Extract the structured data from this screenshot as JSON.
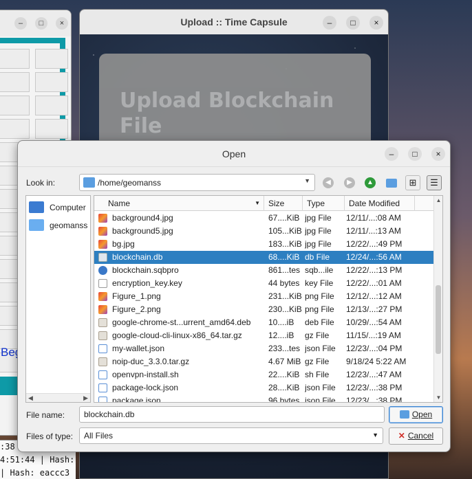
{
  "left_window": {
    "link_text": "Beg",
    "log_lines": [
      ":38  | Hash: 0ge",
      "4:51:44  | Hash:",
      "| Hash: eaccc3"
    ]
  },
  "upload_window": {
    "title": "Upload :: Time Capsule",
    "heading": "Upload Blockchain File"
  },
  "dialog": {
    "title": "Open",
    "look_in_label": "Look in:",
    "look_in_path": "/home/geomanss",
    "sidebar": [
      {
        "label": "Computer",
        "icon": "computer-icon"
      },
      {
        "label": "geomanss",
        "icon": "folder-icon"
      }
    ],
    "columns": {
      "name": "Name",
      "size": "Size",
      "type": "Type",
      "modified": "Date Modified"
    },
    "files": [
      {
        "name": "background4.jpg",
        "size": "67....KiB",
        "type": "jpg File",
        "modified": "12/11/...:08 AM",
        "icon": "img"
      },
      {
        "name": "background5.jpg",
        "size": "105...KiB",
        "type": "jpg File",
        "modified": "12/11/...:13 AM",
        "icon": "img"
      },
      {
        "name": "bg.jpg",
        "size": "183...KiB",
        "type": "jpg File",
        "modified": "12/22/...:49 PM",
        "icon": "img"
      },
      {
        "name": "blockchain.db",
        "size": "68....KiB",
        "type": "db File",
        "modified": "12/24/...:56 AM",
        "icon": "db",
        "selected": true
      },
      {
        "name": "blockchain.sqbpro",
        "size": "861...tes",
        "type": "sqb...ile",
        "modified": "12/22/...:13 PM",
        "icon": "sqb"
      },
      {
        "name": "encryption_key.key",
        "size": "44 bytes",
        "type": "key File",
        "modified": "12/22/...:01 AM",
        "icon": "doc"
      },
      {
        "name": "Figure_1.png",
        "size": "231...KiB",
        "type": "png File",
        "modified": "12/12/...:12 AM",
        "icon": "img"
      },
      {
        "name": "Figure_2.png",
        "size": "230...KiB",
        "type": "png File",
        "modified": "12/13/...:27 PM",
        "icon": "img"
      },
      {
        "name": "google-chrome-st...urrent_amd64.deb",
        "size": "10....iB",
        "type": "deb File",
        "modified": "10/29/...:54 AM",
        "icon": "arc"
      },
      {
        "name": "google-cloud-cli-linux-x86_64.tar.gz",
        "size": "12....iB",
        "type": "gz File",
        "modified": "11/15/...:19 AM",
        "icon": "arc"
      },
      {
        "name": "my-wallet.json",
        "size": "233...tes",
        "type": "json File",
        "modified": "12/23/...:04 PM",
        "icon": "json"
      },
      {
        "name": "noip-duc_3.3.0.tar.gz",
        "size": "4.67 MiB",
        "type": "gz File",
        "modified": "9/18/24 5:22 AM",
        "icon": "arc"
      },
      {
        "name": "openvpn-install.sh",
        "size": "22....KiB",
        "type": "sh File",
        "modified": "12/23/...:47 AM",
        "icon": "json"
      },
      {
        "name": "package-lock.json",
        "size": "28....KiB",
        "type": "json File",
        "modified": "12/23/...:38 PM",
        "icon": "json"
      },
      {
        "name": "package.json",
        "size": "96 bytes",
        "type": "json File",
        "modified": "12/23/...:38 PM",
        "icon": "json"
      }
    ],
    "file_name_label": "File name:",
    "file_name_value": "blockchain.db",
    "file_type_label": "Files of type:",
    "file_type_value": "All Files",
    "open_button": "Open",
    "cancel_button": "Cancel"
  },
  "colors": {
    "accent": "#2d7fc1",
    "teal": "#0e9aa7",
    "link_blue": "#1133cc"
  }
}
